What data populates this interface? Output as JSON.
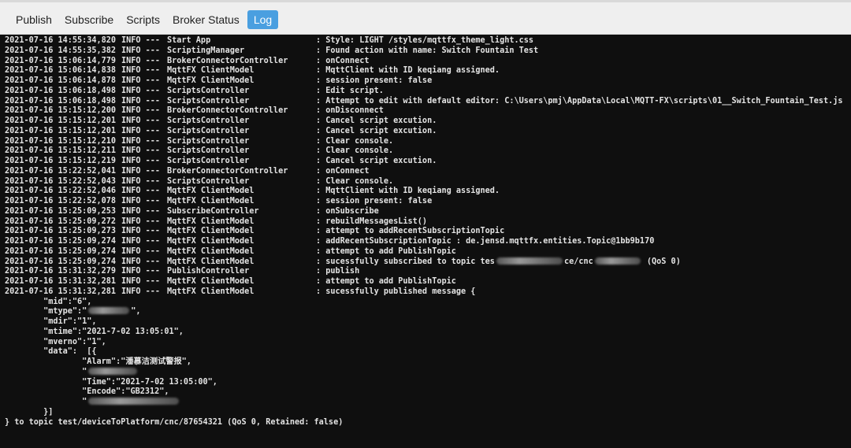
{
  "tabs": [
    {
      "label": "Publish",
      "active": false
    },
    {
      "label": "Subscribe",
      "active": false
    },
    {
      "label": "Scripts",
      "active": false
    },
    {
      "label": "Broker Status",
      "active": false
    },
    {
      "label": "Log",
      "active": true
    }
  ],
  "log_entries": [
    {
      "timestamp": "2021-07-16 14:55:34,820",
      "level": "INFO ---",
      "source": "Start App",
      "message": ": Style: LIGHT /styles/mqttfx_theme_light.css"
    },
    {
      "timestamp": "2021-07-16 14:55:35,382",
      "level": "INFO ---",
      "source": "ScriptingManager",
      "message": ": Found action with name: Switch Fountain Test"
    },
    {
      "timestamp": "2021-07-16 15:06:14,779",
      "level": "INFO ---",
      "source": "BrokerConnectorController",
      "message": ": onConnect"
    },
    {
      "timestamp": "2021-07-16 15:06:14,838",
      "level": "INFO ---",
      "source": "MqttFX ClientModel",
      "message": ": MqttClient with ID keqiang assigned."
    },
    {
      "timestamp": "2021-07-16 15:06:14,878",
      "level": "INFO ---",
      "source": "MqttFX ClientModel",
      "message": ": session present: false"
    },
    {
      "timestamp": "2021-07-16 15:06:18,498",
      "level": "INFO ---",
      "source": "ScriptsController",
      "message": ": Edit script."
    },
    {
      "timestamp": "2021-07-16 15:06:18,498",
      "level": "INFO ---",
      "source": "ScriptsController",
      "message": ": Attempt to edit with default editor: C:\\Users\\pmj\\AppData\\Local\\MQTT-FX\\scripts\\01__Switch_Fountain_Test.js"
    },
    {
      "timestamp": "2021-07-16 15:15:12,200",
      "level": "INFO ---",
      "source": "BrokerConnectorController",
      "message": ": onDisconnect"
    },
    {
      "timestamp": "2021-07-16 15:15:12,201",
      "level": "INFO ---",
      "source": "ScriptsController",
      "message": ": Cancel script excution."
    },
    {
      "timestamp": "2021-07-16 15:15:12,201",
      "level": "INFO ---",
      "source": "ScriptsController",
      "message": ": Cancel script excution."
    },
    {
      "timestamp": "2021-07-16 15:15:12,210",
      "level": "INFO ---",
      "source": "ScriptsController",
      "message": ": Clear console."
    },
    {
      "timestamp": "2021-07-16 15:15:12,211",
      "level": "INFO ---",
      "source": "ScriptsController",
      "message": ": Clear console."
    },
    {
      "timestamp": "2021-07-16 15:15:12,219",
      "level": "INFO ---",
      "source": "ScriptsController",
      "message": ": Cancel script excution."
    },
    {
      "timestamp": "2021-07-16 15:22:52,041",
      "level": "INFO ---",
      "source": "BrokerConnectorController",
      "message": ": onConnect"
    },
    {
      "timestamp": "2021-07-16 15:22:52,043",
      "level": "INFO ---",
      "source": "ScriptsController",
      "message": ": Clear console."
    },
    {
      "timestamp": "2021-07-16 15:22:52,046",
      "level": "INFO ---",
      "source": "MqttFX ClientModel",
      "message": ": MqttClient with ID keqiang assigned."
    },
    {
      "timestamp": "2021-07-16 15:22:52,078",
      "level": "INFO ---",
      "source": "MqttFX ClientModel",
      "message": ": session present: false"
    },
    {
      "timestamp": "2021-07-16 15:25:09,253",
      "level": "INFO ---",
      "source": "SubscribeController",
      "message": ": onSubscribe"
    },
    {
      "timestamp": "2021-07-16 15:25:09,272",
      "level": "INFO ---",
      "source": "MqttFX ClientModel",
      "message": ": rebuildMessagesList()"
    },
    {
      "timestamp": "2021-07-16 15:25:09,273",
      "level": "INFO ---",
      "source": "MqttFX ClientModel",
      "message": ": attempt to addRecentSubscriptionTopic"
    },
    {
      "timestamp": "2021-07-16 15:25:09,274",
      "level": "INFO ---",
      "source": "MqttFX ClientModel",
      "message": ": addRecentSubscriptionTopic : de.jensd.mqttfx.entities.Topic@1bb9b170"
    },
    {
      "timestamp": "2021-07-16 15:25:09,274",
      "level": "INFO ---",
      "source": "MqttFX ClientModel",
      "message": ": attempt to add PublishTopic"
    },
    {
      "timestamp": "2021-07-16 15:25:09,274",
      "level": "INFO ---",
      "source": "MqttFX ClientModel",
      "message": ": sucessfully subscribed to topic tes",
      "redacted": "ce/cnc",
      "message_tail": "(QoS 0)"
    },
    {
      "timestamp": "2021-07-16 15:31:32,279",
      "level": "INFO ---",
      "source": "PublishController",
      "message": ": publish"
    },
    {
      "timestamp": "2021-07-16 15:31:32,281",
      "level": "INFO ---",
      "source": "MqttFX ClientModel",
      "message": ": attempt to add PublishTopic"
    },
    {
      "timestamp": "2021-07-16 15:31:32,281",
      "level": "INFO ---",
      "source": "MqttFX ClientModel",
      "message": ": sucessfully published message {"
    }
  ],
  "payload_lines": [
    "        \"mid\":\"6\",",
    "        \"mtype\":\"",
    "        \"mdir\":\"1\",",
    "        \"mtime\":\"2021-7-02 13:05:01\",",
    "        \"mverno\":\"1\",",
    "        \"data\":  [{",
    "                \"Alarm\":\"潘慕洁测试警报\",",
    "                \"",
    "                \"Time\":\"2021-7-02 13:05:00\",",
    "                \"Encode\":\"GB2312\",",
    "                \"",
    "        }]",
    "} to topic test/deviceToPlatform/cnc/87654321 (QoS 0, Retained: false)"
  ]
}
